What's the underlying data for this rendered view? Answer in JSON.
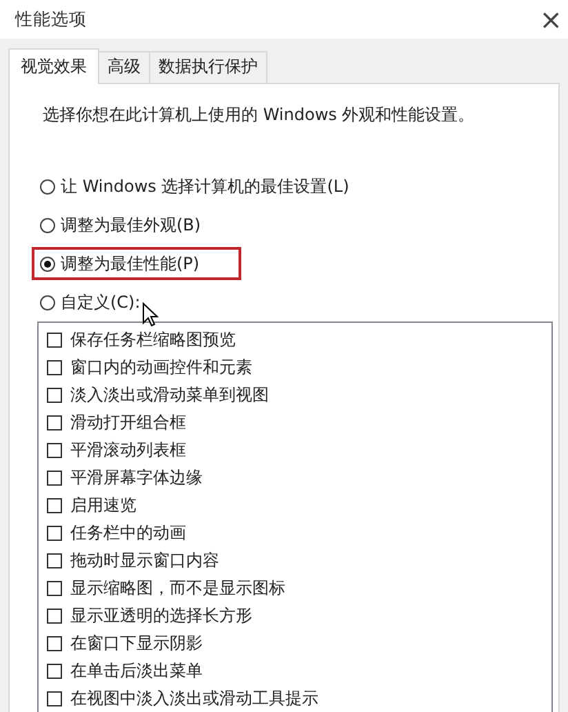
{
  "window": {
    "title": "性能选项",
    "close": "×"
  },
  "tabs": [
    {
      "label": "视觉效果",
      "selected": true
    },
    {
      "label": "高级",
      "selected": false
    },
    {
      "label": "数据执行保护",
      "selected": false
    }
  ],
  "description": "选择你想在此计算机上使用的 Windows 外观和性能设置。",
  "options": [
    {
      "label": "让 Windows 选择计算机的最佳设置(L)",
      "selected": false,
      "highlighted": false
    },
    {
      "label": "调整为最佳外观(B)",
      "selected": false,
      "highlighted": false
    },
    {
      "label": "调整为最佳性能(P)",
      "selected": true,
      "highlighted": true
    },
    {
      "label": "自定义(C):",
      "selected": false,
      "highlighted": false
    }
  ],
  "effects": [
    {
      "label": "保存任务栏缩略图预览",
      "checked": false
    },
    {
      "label": "窗口内的动画控件和元素",
      "checked": false
    },
    {
      "label": "淡入淡出或滑动菜单到视图",
      "checked": false
    },
    {
      "label": "滑动打开组合框",
      "checked": false
    },
    {
      "label": "平滑滚动列表框",
      "checked": false
    },
    {
      "label": "平滑屏幕字体边缘",
      "checked": false
    },
    {
      "label": "启用速览",
      "checked": false
    },
    {
      "label": "任务栏中的动画",
      "checked": false
    },
    {
      "label": "拖动时显示窗口内容",
      "checked": false
    },
    {
      "label": "显示缩略图，而不是显示图标",
      "checked": false
    },
    {
      "label": "显示亚透明的选择长方形",
      "checked": false
    },
    {
      "label": "在窗口下显示阴影",
      "checked": false
    },
    {
      "label": "在单击后淡出菜单",
      "checked": false
    },
    {
      "label": "在视图中淡入淡出或滑动工具提示",
      "checked": false
    }
  ]
}
